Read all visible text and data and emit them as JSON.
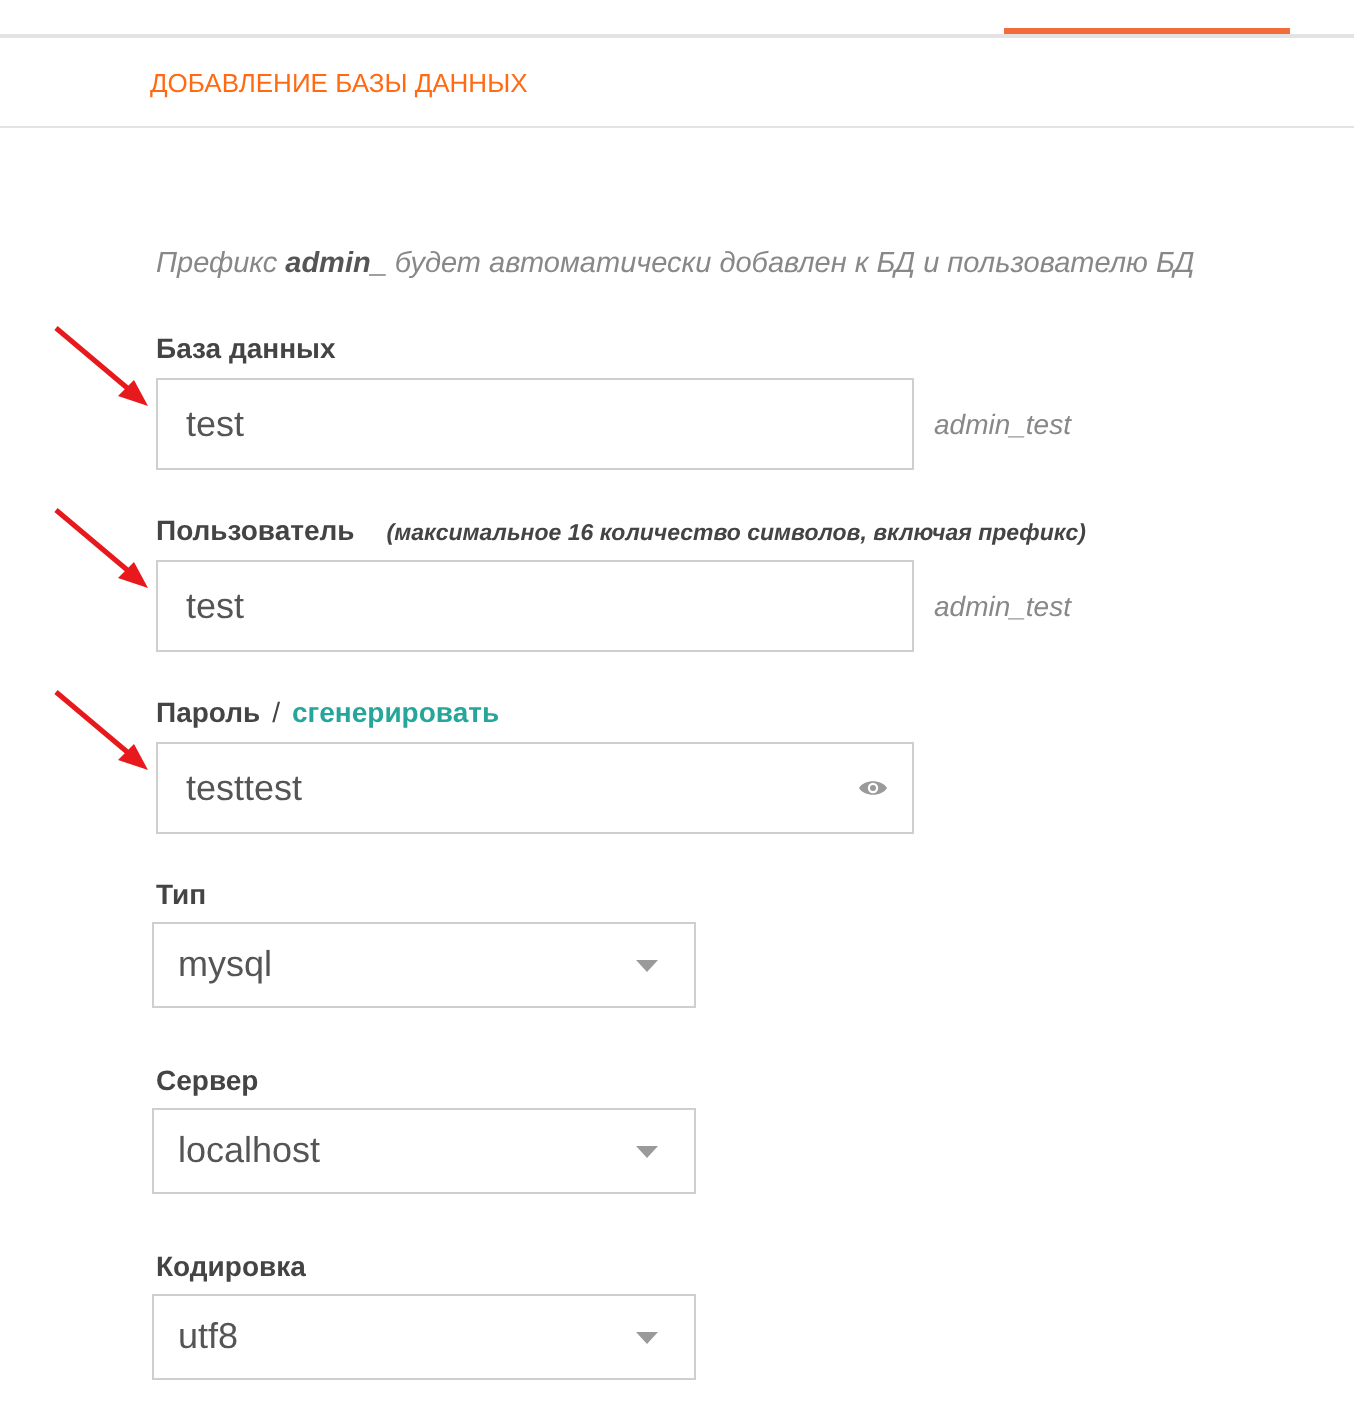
{
  "header": {
    "title": "ДОБАВЛЕНИЕ БАЗЫ ДАННЫХ"
  },
  "hint": "Префикс **admin_** будет автоматически добавлен к БД и пользователю БД",
  "fields": [
    {
      "kind": "text",
      "label": "База данных",
      "value": "test",
      "suffix": "admin_test",
      "annotated": true
    },
    {
      "kind": "text",
      "label": "Пользователь",
      "note": "(максимальное 16 количество символов, включая префикс)",
      "value": "test",
      "suffix": "admin_test",
      "annotated": true
    },
    {
      "kind": "password",
      "label": "Пароль",
      "separator": "/",
      "link": "сгенерировать",
      "value": "testtest",
      "annotated": true
    },
    {
      "kind": "select",
      "label": "Тип",
      "value": "mysql",
      "annotated": false
    },
    {
      "kind": "select",
      "label": "Сервер",
      "value": "localhost",
      "annotated": false
    },
    {
      "kind": "select",
      "label": "Кодировка",
      "value": "utf8",
      "annotated": false
    }
  ]
}
